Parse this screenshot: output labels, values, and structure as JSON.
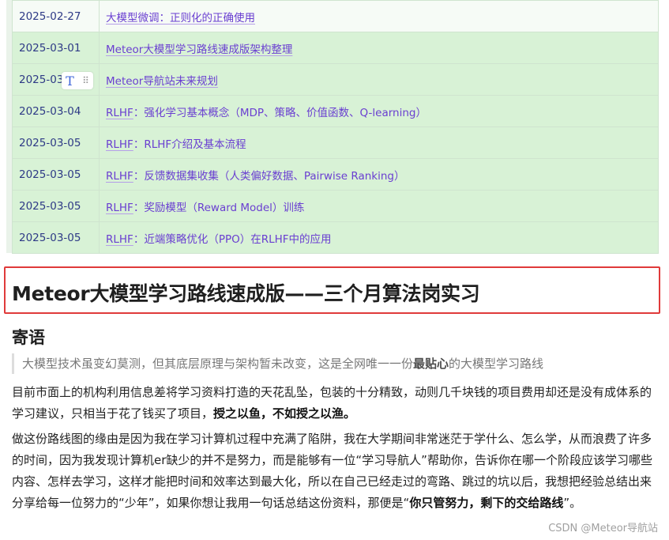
{
  "table": {
    "rows": [
      {
        "date": "2025-02-27",
        "parts": [
          {
            "t": "大模型微调：正则化的正确使用",
            "u": true
          }
        ]
      },
      {
        "date": "2025-03-01",
        "parts": [
          {
            "t": "Meteor大模型学习路线速成版架构整理",
            "u": true
          }
        ]
      },
      {
        "date": "2025-03",
        "parts": [
          {
            "t": "Meteor导航站未来规划",
            "u": true
          }
        ]
      },
      {
        "date": "2025-03-04",
        "parts": [
          {
            "t": "RLHF",
            "u": true
          },
          {
            "t": "：强化学习基本概念（MDP、策略、价值函数、Q-learning）",
            "u": false
          }
        ]
      },
      {
        "date": "2025-03-05",
        "parts": [
          {
            "t": "RLHF",
            "u": true
          },
          {
            "t": "：RLHF介绍及基本流程",
            "u": false
          }
        ]
      },
      {
        "date": "2025-03-05",
        "parts": [
          {
            "t": "RLHF",
            "u": true
          },
          {
            "t": "：反馈数据集收集（人类偏好数据、Pairwise Ranking）",
            "u": false
          }
        ]
      },
      {
        "date": "2025-03-05",
        "parts": [
          {
            "t": "RLHF",
            "u": true
          },
          {
            "t": "：奖励模型（Reward Model）训练",
            "u": false
          }
        ]
      },
      {
        "date": "2025-03-05",
        "parts": [
          {
            "t": "RLHF",
            "u": true
          },
          {
            "t": "：近端策略优化（PPO）在RLHF中的应用",
            "u": false
          }
        ]
      }
    ]
  },
  "hover_tools": {
    "text_icon": "T",
    "drag_icon": "⠿"
  },
  "article": {
    "heading": "Meteor大模型学习路线速成版——三个月算法岗实习",
    "subheading": "寄语",
    "quote": {
      "before": "大模型技术虽变幻莫测，但其底层原理与架构暂未改变，这是全网唯一一份",
      "bold": "最贴心",
      "after": "的大模型学习路线"
    },
    "paragraph1": {
      "text": "目前市面上的机构利用信息差将学习资料打造的天花乱坠，包装的十分精致，动则几千块钱的项目费用却还是没有成体系的学习建议，只相当于花了钱买了项目，",
      "bold": "授之以鱼，不如授之以渔。"
    },
    "paragraph2": {
      "text": "做这份路线图的缘由是因为我在学习计算机过程中充满了陷阱，我在大学期间非常迷茫于学什么、怎么学，从而浪费了许多的时间，因为我发现计算机er缺少的并不是努力，而是能够有一位“学习导航人”帮助你，告诉你在哪一个阶段应该学习哪些内容、怎样去学习，这样才能把时间和效率达到最大化，所以在自己已经走过的弯路、跳过的坑以后，我想把经验总结出来分享给每一位努力的“少年”，如果你想让我用一句话总结这份资料，那便是“",
      "bold": "你只管努力，剩下的交给路线",
      "after": "”。"
    }
  },
  "watermark": "CSDN @Meteor导航站",
  "colors": {
    "highlight_border": "#e03a3a",
    "row_green": "#d8f2d6",
    "link_purple": "#6a3fd1",
    "date_blue": "#2e3a86"
  }
}
